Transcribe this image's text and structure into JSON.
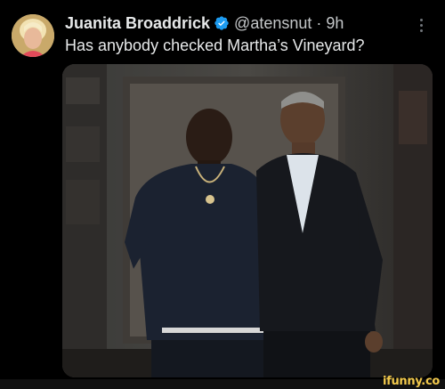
{
  "tweet": {
    "display_name": "Juanita Broaddrick",
    "handle": "@atensnut",
    "separator": "·",
    "time": "9h",
    "text": "Has anybody checked Martha’s Vineyard?"
  },
  "icons": {
    "verified": "verified-badge-icon",
    "more": "more-options-icon"
  },
  "colors": {
    "background": "#000000",
    "verified": "#1d9bf0",
    "text_primary": "#e7e9ea",
    "text_secondary": "#71767b",
    "watermark": "#f2c94c"
  },
  "watermark": "ifunny.co"
}
